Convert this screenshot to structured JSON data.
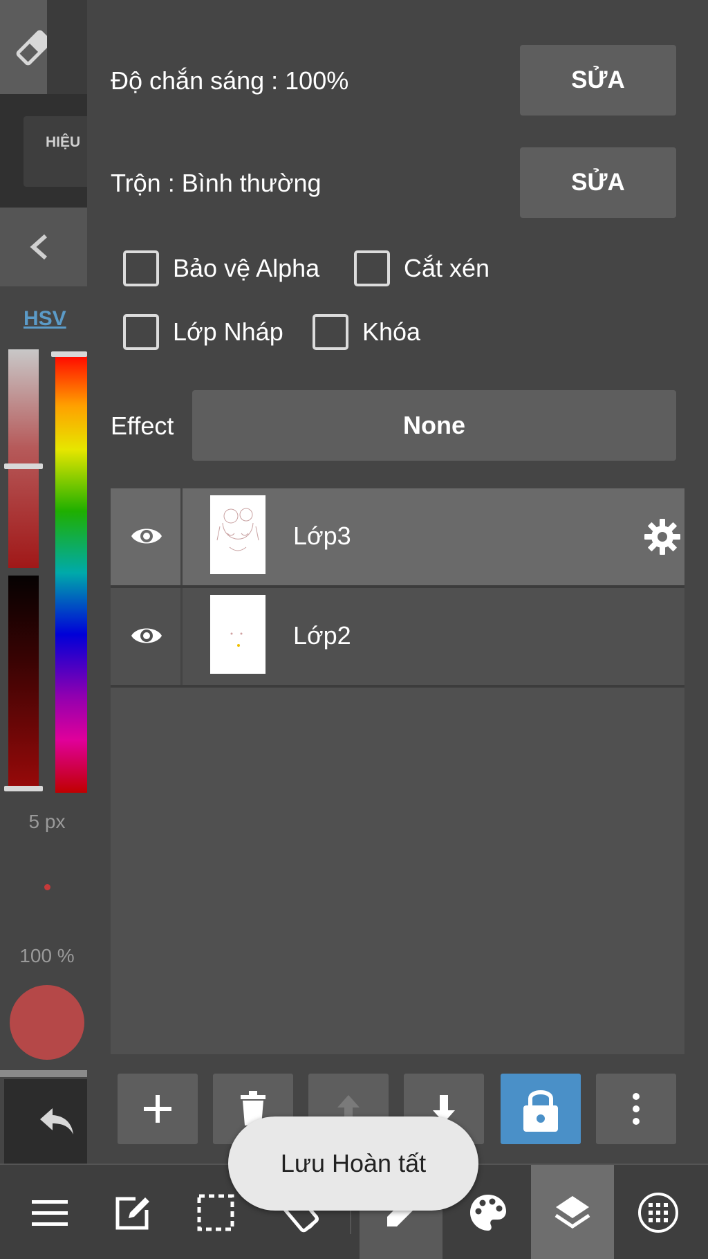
{
  "left_strip": {
    "effect_label": "HIỆU",
    "color_mode": "HSV",
    "brush_size": "5 px",
    "brush_opacity": "100 %",
    "current_color": "#b54848"
  },
  "properties": {
    "opacity_label": "Độ chắn sáng : 100%",
    "opacity_edit": "SỬA",
    "blend_label": "Trộn : Bình thường",
    "blend_edit": "SỬA",
    "checkboxes": {
      "protect_alpha": "Bảo vệ Alpha",
      "clipping": "Cắt xén",
      "draft_layer": "Lớp Nháp",
      "lock": "Khóa"
    },
    "effect_label": "Effect",
    "effect_value": "None"
  },
  "layers": [
    {
      "name": "Lớp3",
      "selected": true
    },
    {
      "name": "Lớp2",
      "selected": false
    }
  ],
  "layer_tools": {
    "lock_active": true,
    "accent": "#4a90c8"
  },
  "toast": "Lưu Hoàn tất"
}
